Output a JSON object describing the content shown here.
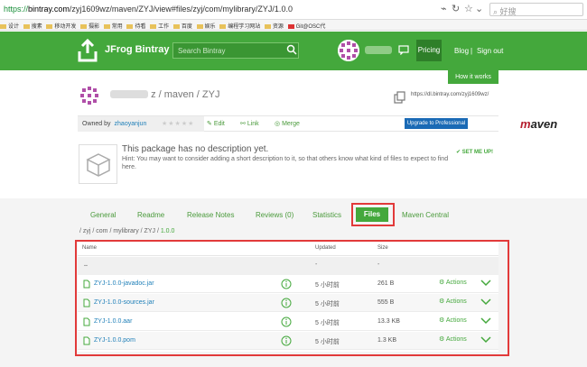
{
  "browser": {
    "url_proto": "https://",
    "url_domain": "bintray.com",
    "url_rest": "/zyj1609wz/maven/ZYJ/view#files/zyj/com/mylibrary/ZYJ/1.0.0",
    "search_placeholder": "好搜",
    "bookmarks": [
      "设计",
      "搜素",
      "移动开发",
      "摄影",
      "常用",
      "待看",
      "工作",
      "百度",
      "娱乐",
      "编程学习网站",
      "资源",
      "Git@OSC代"
    ]
  },
  "header": {
    "logo": "JFrog Bintray",
    "search_placeholder": "Search Bintray",
    "pricing": "Pricing",
    "blog": "Blog",
    "separator": "|",
    "signout": "Sign out",
    "how_it_works": "How it works"
  },
  "package": {
    "crumb": "z / maven / ZYJ",
    "download_url": "https://dl.bintray.com/zyj1609wz/",
    "owned_by_label": "Owned by",
    "owner": "zhaoyanjun",
    "edit": "Edit",
    "link": "Link",
    "merge": "Merge",
    "upgrade": "Upgrade to Professional",
    "maven_prefix": "m",
    "maven_rest": "aven",
    "no_desc": "This package has no description yet.",
    "hint": "Hint: You may want to consider adding a short description to it, so that others know what kind of files to expect to find here.",
    "set_me_up": "SET ME UP!"
  },
  "tabs": [
    "General",
    "Readme",
    "Release Notes",
    "Reviews (0)",
    "Statistics",
    "Files",
    "Maven Central"
  ],
  "path": {
    "prefix": "/ zyj / com / mylibrary / ZYJ / ",
    "version": "1.0.0"
  },
  "table": {
    "headers": {
      "name": "Name",
      "updated": "Updated",
      "size": "Size"
    },
    "parent": {
      "name": "..",
      "updated": "-",
      "size": "-"
    },
    "rows": [
      {
        "name": "ZYJ-1.0.0-javadoc.jar",
        "updated": "5 小时前",
        "size": "261 B",
        "actions": "Actions"
      },
      {
        "name": "ZYJ-1.0.0-sources.jar",
        "updated": "5 小时前",
        "size": "555 B",
        "actions": "Actions"
      },
      {
        "name": "ZYJ-1.0.0.aar",
        "updated": "5 小时前",
        "size": "13.3 KB",
        "actions": "Actions"
      },
      {
        "name": "ZYJ-1.0.0.pom",
        "updated": "5 小时前",
        "size": "1.3 KB",
        "actions": "Actions"
      }
    ]
  },
  "colors": {
    "brand": "#44a83c",
    "highlight": "#e23a3a",
    "link": "#1e7fb8"
  }
}
